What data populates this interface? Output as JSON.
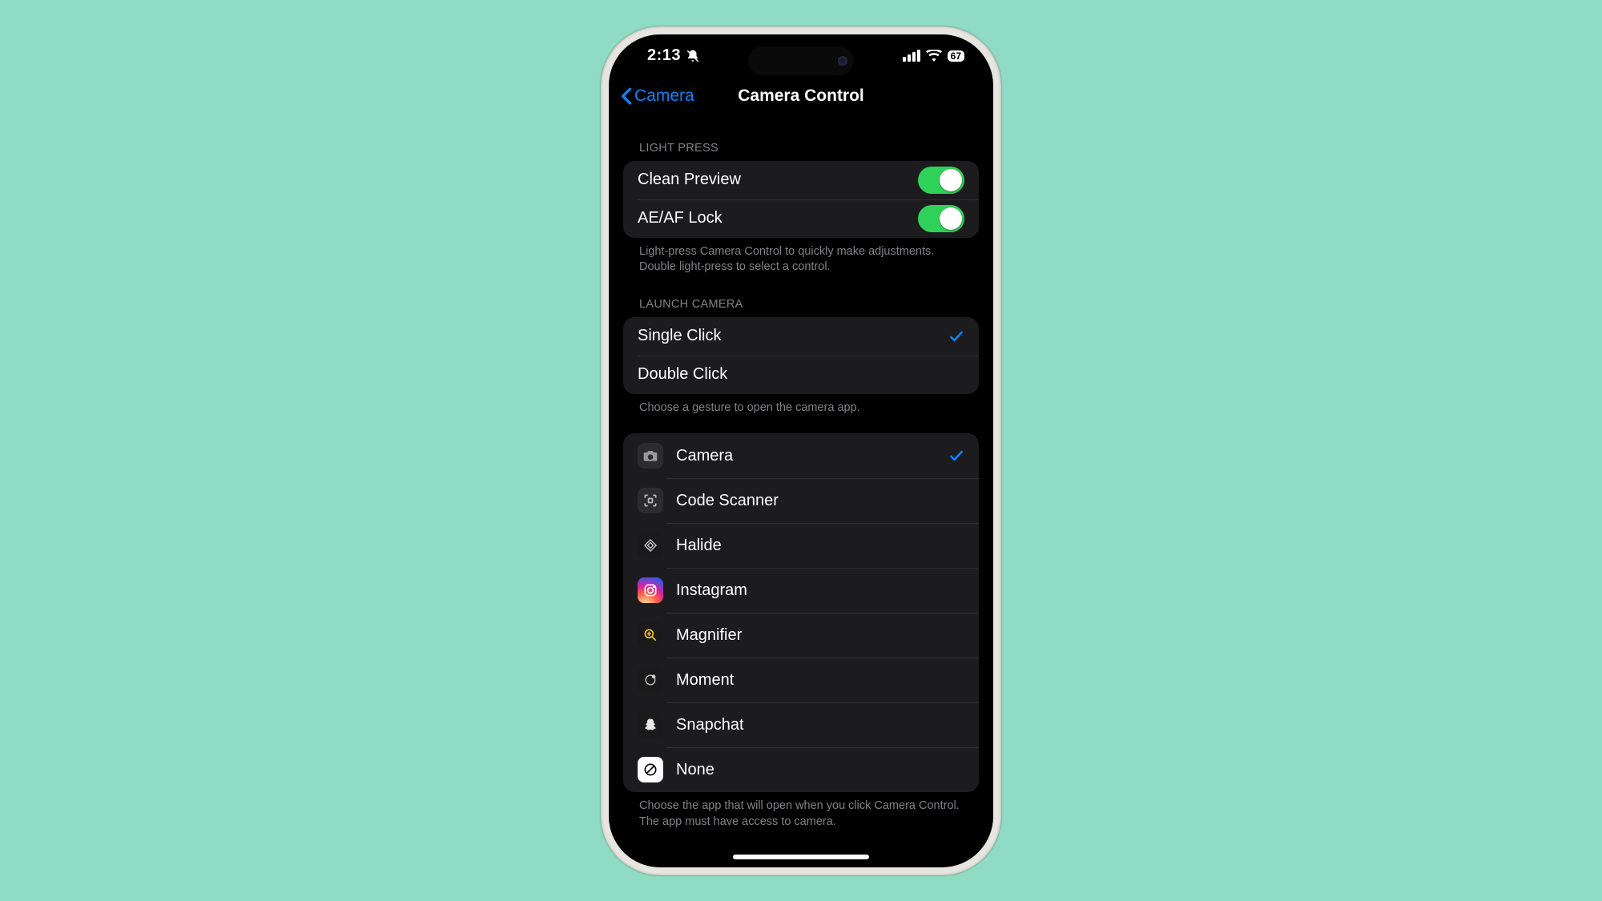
{
  "status": {
    "time": "2:13",
    "battery": "67"
  },
  "nav": {
    "back_label": "Camera",
    "title": "Camera Control"
  },
  "sections": {
    "light_press": {
      "header": "Light Press",
      "items": {
        "clean_preview": {
          "label": "Clean Preview",
          "on": true
        },
        "aeaf_lock": {
          "label": "AE/AF Lock",
          "on": true
        }
      },
      "footer": "Light-press Camera Control to quickly make adjustments. Double light-press to select a control."
    },
    "launch_camera": {
      "header": "Launch Camera",
      "items": {
        "single": {
          "label": "Single Click",
          "selected": true
        },
        "double": {
          "label": "Double Click",
          "selected": false
        }
      },
      "footer": "Choose a gesture to open the camera app."
    },
    "apps": {
      "items": {
        "camera": {
          "label": "Camera",
          "selected": true
        },
        "code_scanner": {
          "label": "Code Scanner",
          "selected": false
        },
        "halide": {
          "label": "Halide",
          "selected": false
        },
        "instagram": {
          "label": "Instagram",
          "selected": false
        },
        "magnifier": {
          "label": "Magnifier",
          "selected": false
        },
        "moment": {
          "label": "Moment",
          "selected": false
        },
        "snapchat": {
          "label": "Snapchat",
          "selected": false
        },
        "none": {
          "label": "None",
          "selected": false
        }
      },
      "footer": "Choose the app that will open when you click Camera Control. The app must have access to camera."
    }
  },
  "colors": {
    "background": "#8fdbc4",
    "accent": "#0a84ff",
    "toggle_on": "#30d158",
    "group_bg": "#1c1c1e"
  }
}
